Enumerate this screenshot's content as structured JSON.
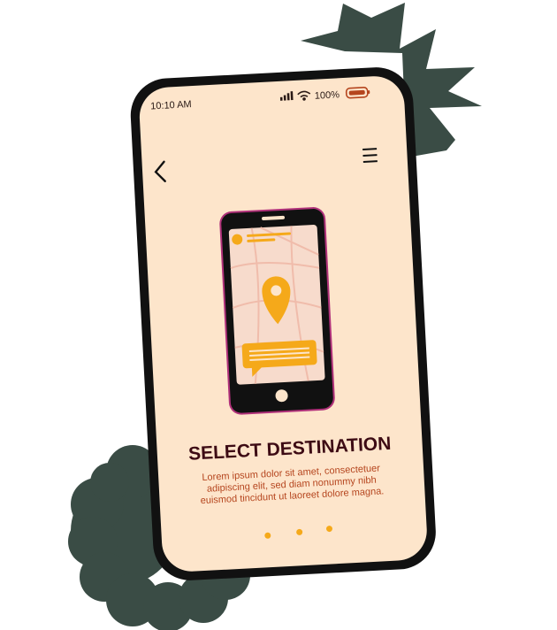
{
  "status_bar": {
    "time": "10:10 AM",
    "battery": "100%",
    "icons": [
      "signal-icon",
      "wifi-icon",
      "battery-icon"
    ]
  },
  "nav": {
    "back_icon": "back-arrow-icon",
    "menu_icon": "hamburger-menu-icon"
  },
  "illustration": {
    "icon": "map-location-pin-icon",
    "chat_icon": "chat-bubble-icon"
  },
  "content": {
    "title": "SELECT DESTINATION",
    "description_lines": [
      "Lorem ipsum dolor sit amet, consectetuer",
      "adipiscing elit, sed diam nonummy nibh",
      "euismod tincidunt ut laoreet dolore magna."
    ]
  },
  "pagination": {
    "pages": 3,
    "active_index": 0
  },
  "colors": {
    "screen": "#fde5cb",
    "phone_frame": "#111111",
    "blob": "#3a4c45",
    "accent": "#f5a91a",
    "title": "#3d0b14",
    "body_text": "#b5451e",
    "inner_phone_border": "#b0317a"
  }
}
